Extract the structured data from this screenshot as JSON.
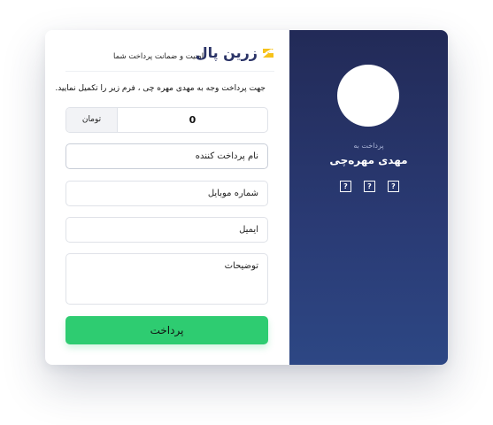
{
  "header": {
    "logo_text": "زرین پال",
    "slogan": "امنیت و ضمانت پرداخت شما"
  },
  "form": {
    "intro": "جهت پرداخت وجه به مهدی مهره چی ، فرم زیر را تکمیل نمایید.",
    "amount_value": "0",
    "currency": "تومان",
    "payer_name_placeholder": "نام پرداخت کننده",
    "mobile_placeholder": "شماره موبایل",
    "email_placeholder": "ایمیل",
    "notes_placeholder": "توضیحات",
    "pay_button": "پرداخت"
  },
  "merchant": {
    "pay_to_label": "پرداخت به",
    "payee_name": "مهدی مهره‌چی",
    "social_icons": [
      "unknown-icon",
      "unknown-icon",
      "unknown-icon"
    ],
    "social_glyph": "?"
  },
  "colors": {
    "side_panel_top": "#222a57",
    "side_panel_bottom": "#2d4784",
    "button": "#2ecc71",
    "logo_yellow": "#f6c21a"
  }
}
